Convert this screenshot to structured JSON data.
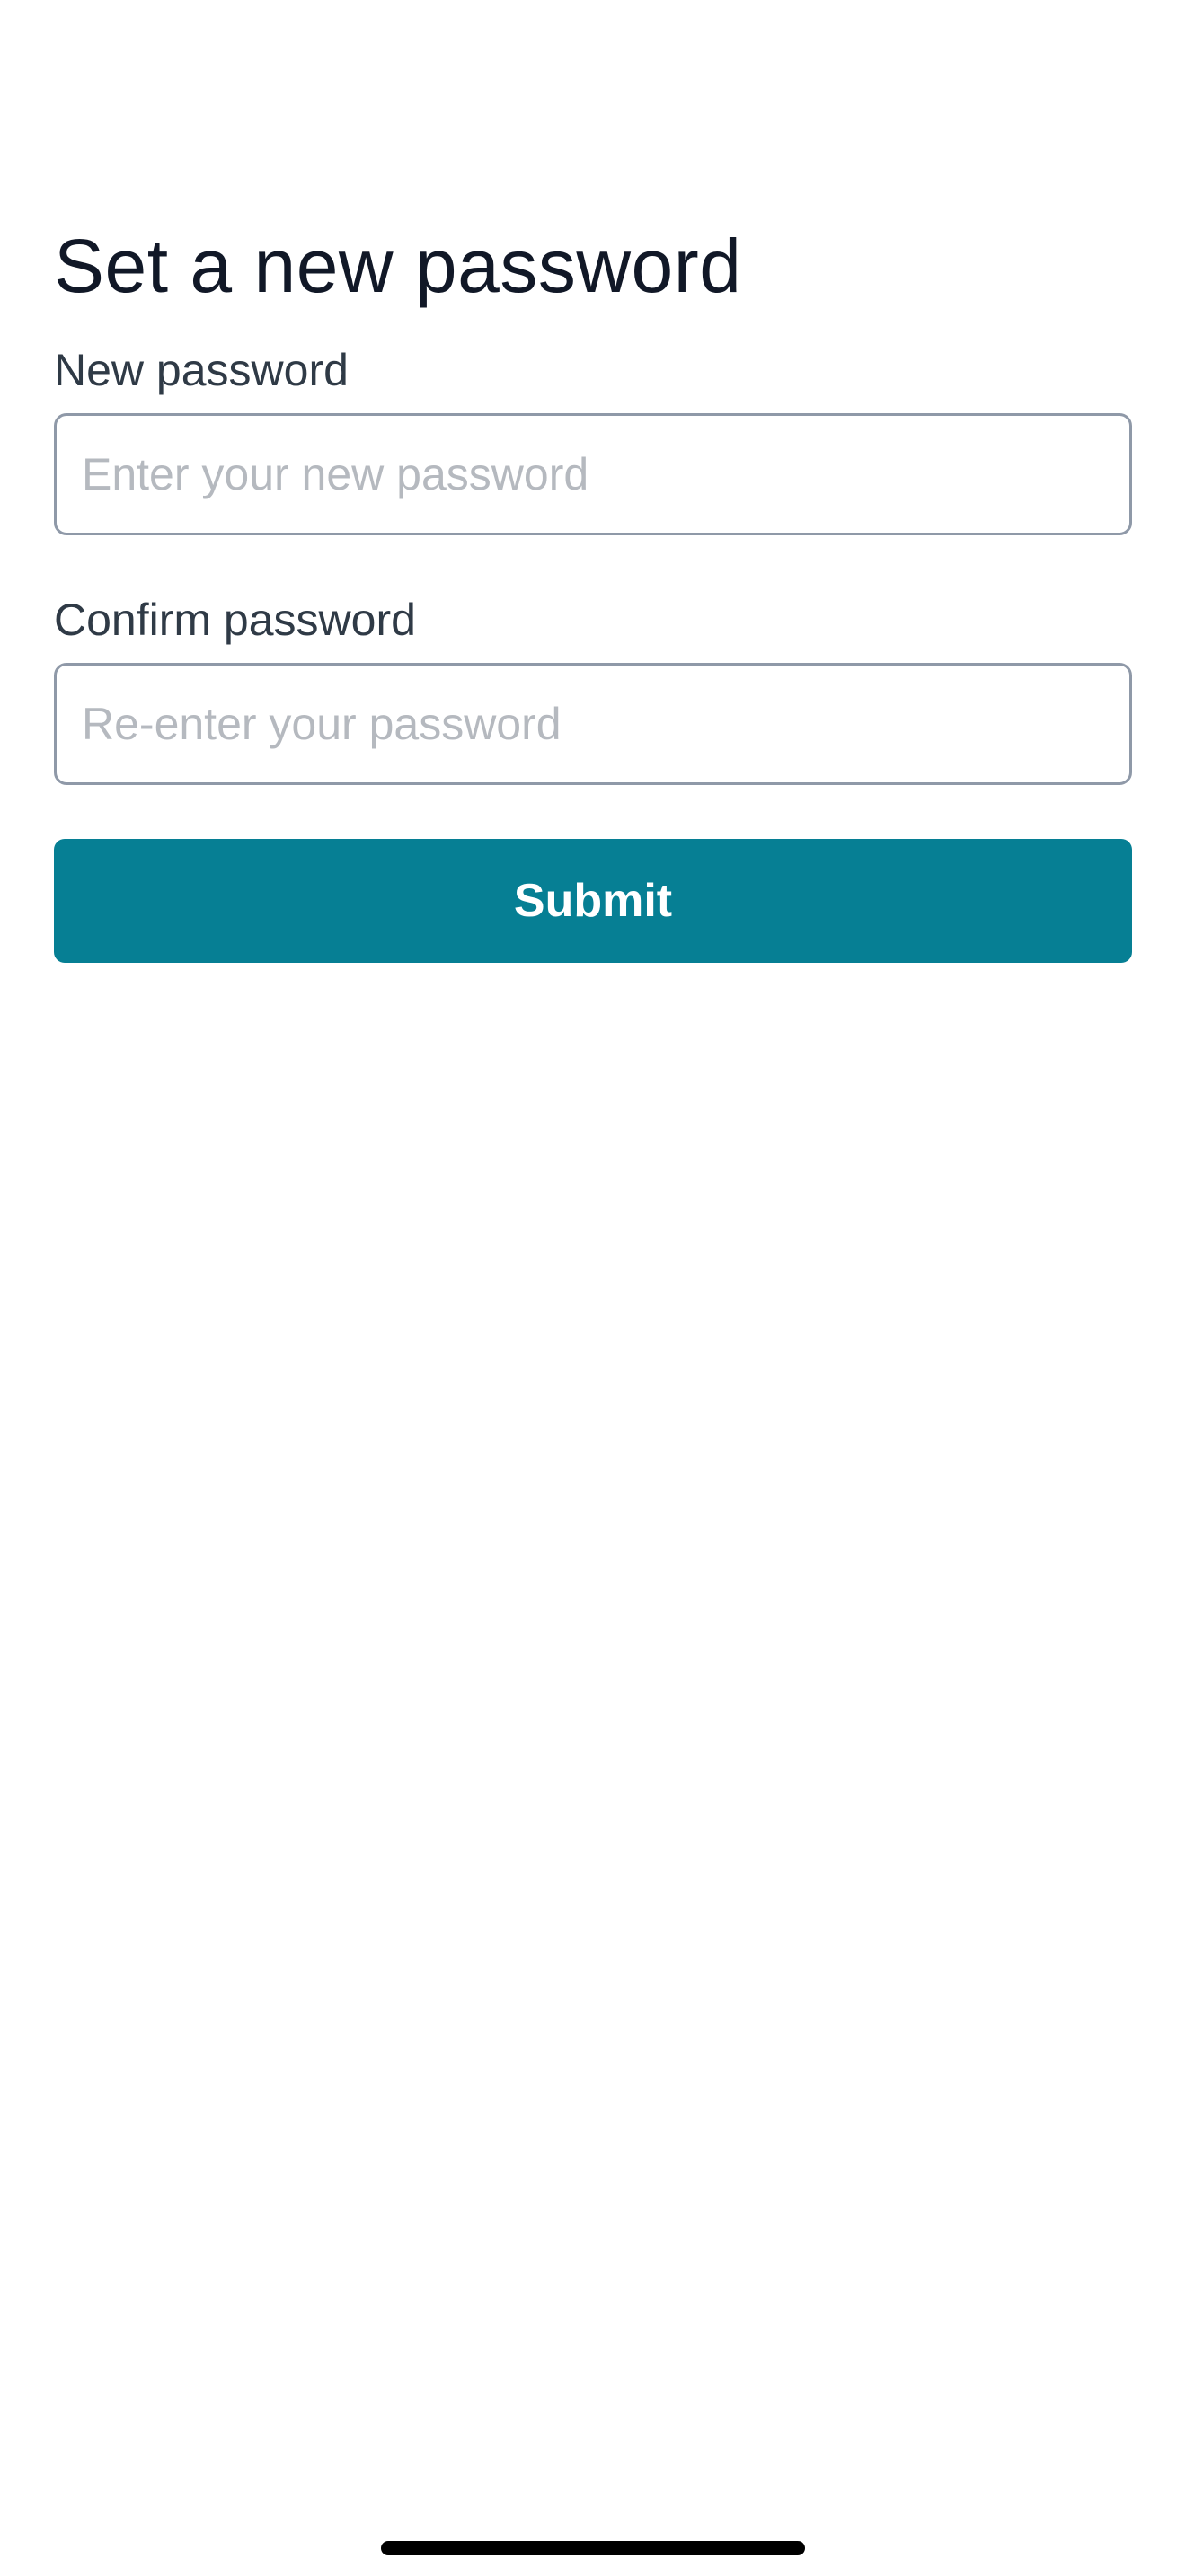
{
  "page": {
    "title": "Set a new password"
  },
  "form": {
    "new_password": {
      "label": "New password",
      "value": "",
      "placeholder": "Enter your new password"
    },
    "confirm_password": {
      "label": "Confirm password",
      "value": "",
      "placeholder": "Re-enter your password"
    },
    "submit_label": "Submit"
  },
  "colors": {
    "background": "#ffffff",
    "title_text": "#111827",
    "label_text": "#2f3a46",
    "input_border": "#8f99a8",
    "placeholder_text": "#b5b9bf",
    "primary_button": "#067f94",
    "button_text": "#ffffff",
    "home_indicator": "#000000"
  }
}
